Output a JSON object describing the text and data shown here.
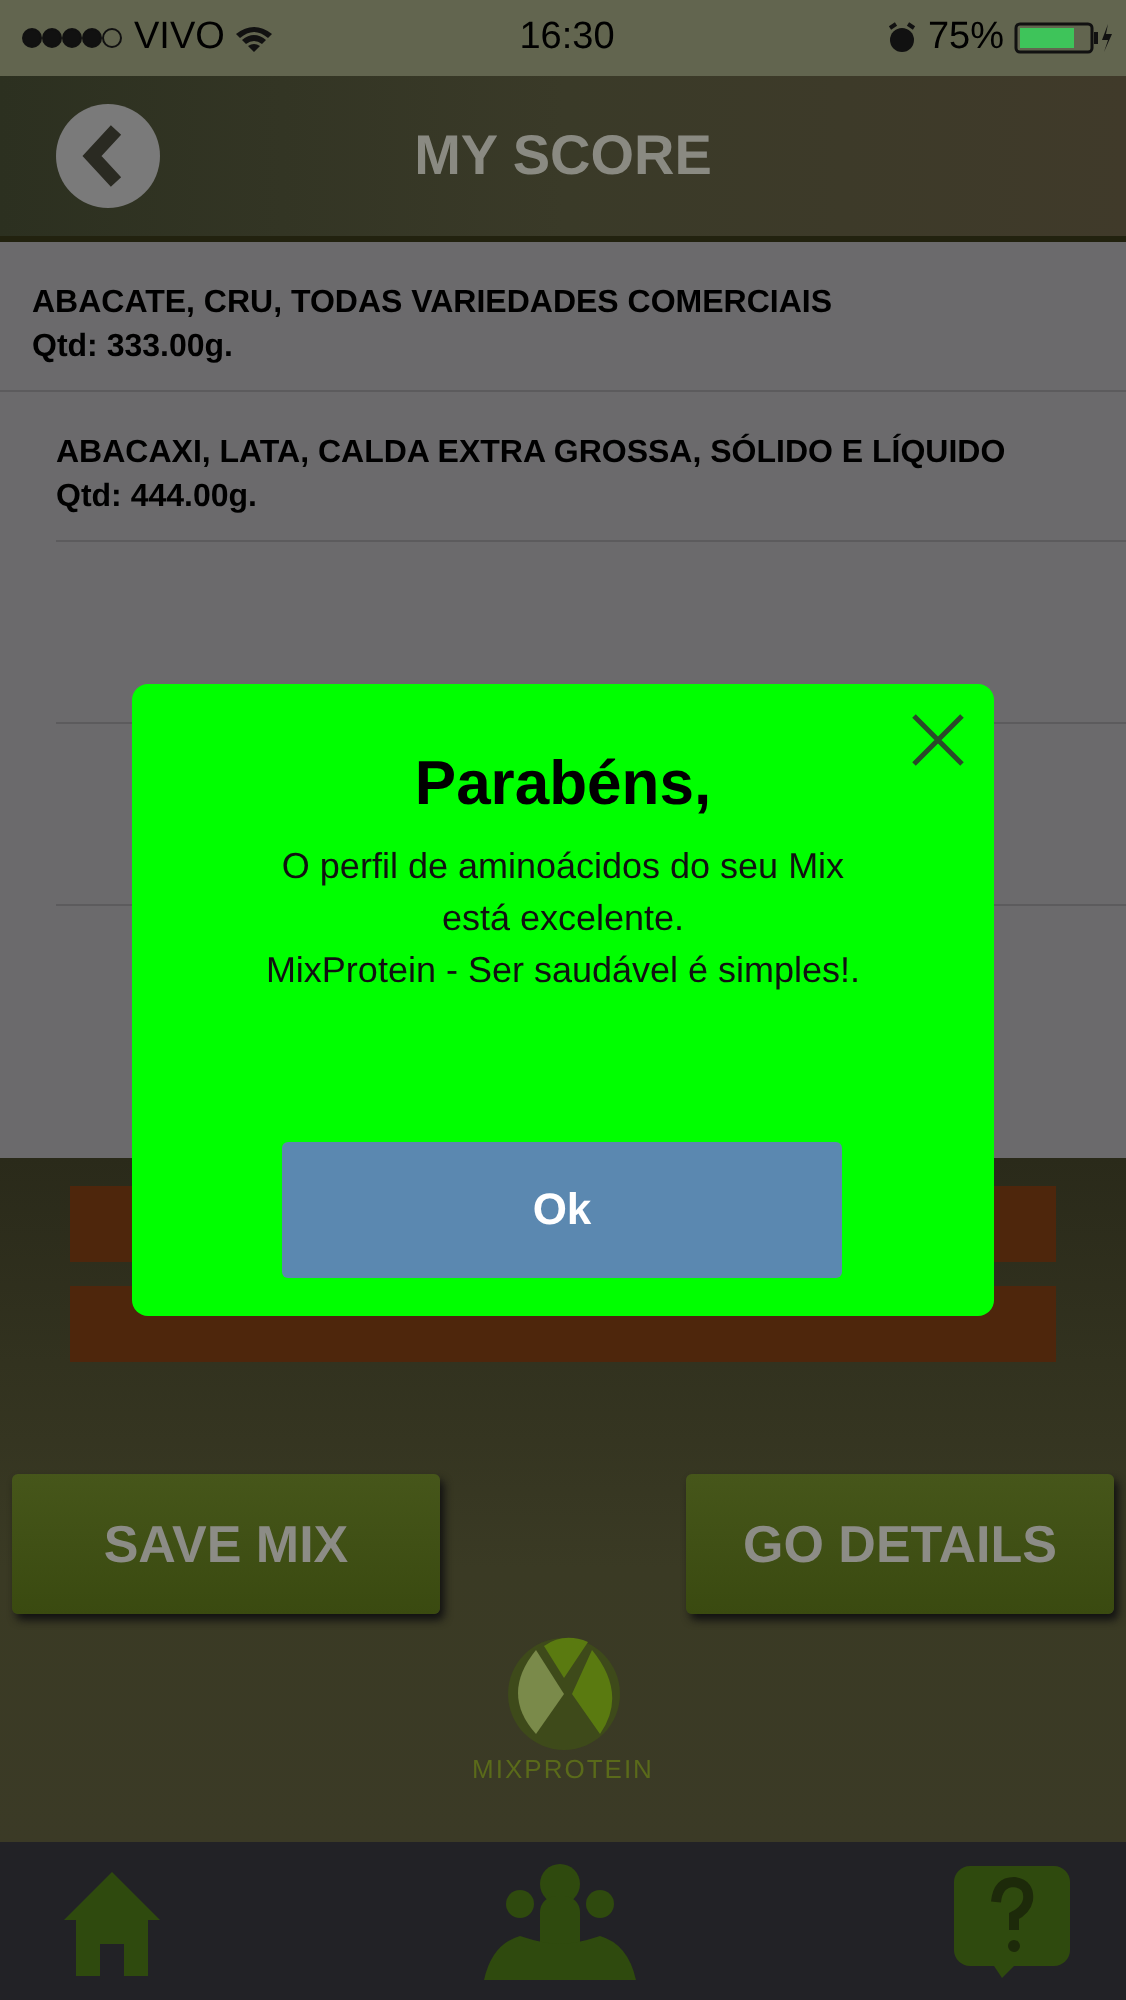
{
  "status_bar": {
    "carrier": "VIVO",
    "time": "16:30",
    "battery": "75%"
  },
  "header": {
    "title": "MY SCORE"
  },
  "items": [
    {
      "name": "ABACATE, CRU, TODAS VARIEDADES COMERCIAIS",
      "quantity": "Qtd: 333.00g."
    },
    {
      "name": "ABACAXI, LATA, CALDA EXTRA GROSSA, SÓLIDO E LÍQUIDO",
      "quantity": "Qtd: 444.00g."
    }
  ],
  "buttons": [
    "SAVE MIX",
    "GO DETAILS"
  ],
  "logo_text": "MIXPROTEIN",
  "tab_bar": [
    {
      "kind": "home"
    },
    {
      "kind": "people"
    },
    {
      "kind": "help"
    }
  ],
  "dialog": {
    "title": "Parabéns,",
    "message": [
      "O perfil de aminoácidos do seu Mix",
      "está excelente.",
      "MixProtein - Ser saudável é simples!."
    ],
    "button": "Ok"
  }
}
